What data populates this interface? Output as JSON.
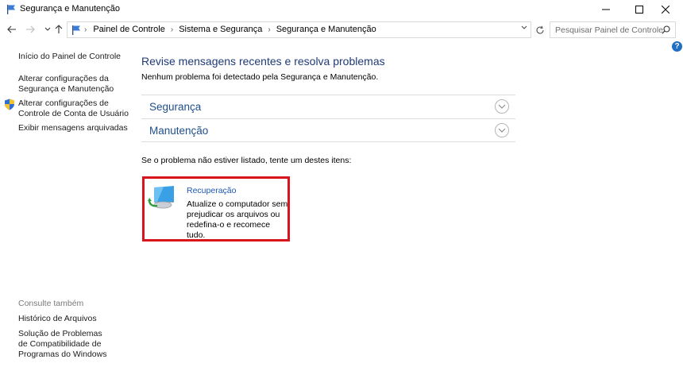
{
  "window": {
    "title": "Segurança e Manutenção"
  },
  "navigation": {
    "breadcrumbs": [
      "Painel de Controle",
      "Sistema e Segurança",
      "Segurança e Manutenção"
    ],
    "search_placeholder": "Pesquisar Painel de Controle"
  },
  "help": {
    "label": "?"
  },
  "sidebar": {
    "links": [
      {
        "label": "Início do Painel de Controle"
      },
      {
        "label": "Alterar configurações da Segurança e Manutenção"
      },
      {
        "label": "Alterar configurações de Controle de Conta de Usuário"
      },
      {
        "label": "Exibir mensagens arquivadas"
      }
    ],
    "see_also_heading": "Consulte também",
    "see_also": [
      {
        "label": "Histórico de Arquivos"
      },
      {
        "label": "Solução de Problemas de Compatibilidade de Programas do Windows"
      }
    ]
  },
  "main": {
    "title": "Revise mensagens recentes e resolva problemas",
    "subtitle": "Nenhum problema foi detectado pela Segurança e Manutenção.",
    "sections": [
      {
        "label": "Segurança"
      },
      {
        "label": "Manutenção"
      }
    ],
    "hint": "Se o problema não estiver listado, tente um destes itens:",
    "recovery": {
      "title": "Recuperação",
      "description": "Atualize o computador sem prejudicar os arquivos ou redefina-o e recomece tudo."
    }
  },
  "colors": {
    "link_blue": "#1e56b3",
    "title_blue": "#1e3a78",
    "highlight_red": "#d9141b"
  }
}
